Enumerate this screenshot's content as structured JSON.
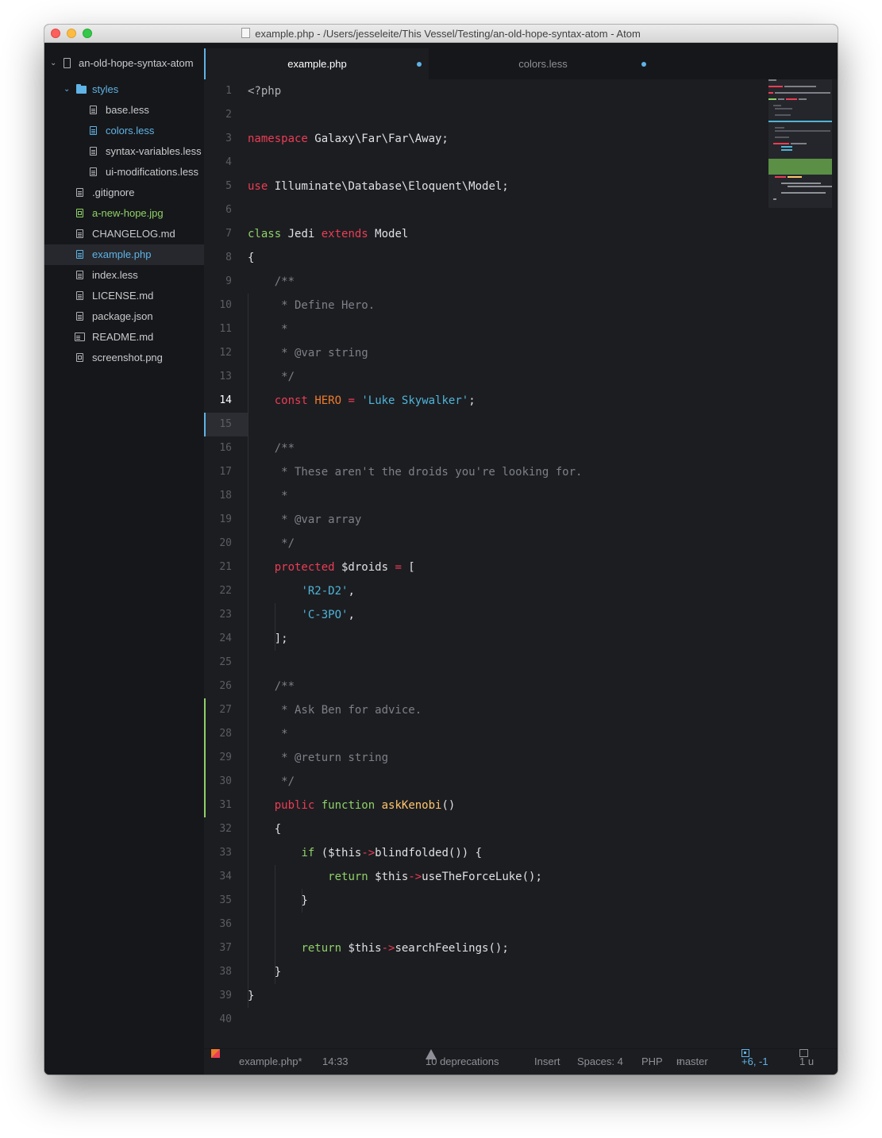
{
  "window": {
    "title": "example.php - /Users/jesseleite/This Vessel/Testing/an-old-hope-syntax-atom - Atom"
  },
  "sidebar": {
    "project": "an-old-hope-syntax-atom",
    "folder": "styles",
    "folder_items": [
      "base.less",
      "colors.less",
      "syntax-variables.less",
      "ui-modifications.less"
    ],
    "root_items": [
      ".gitignore",
      "a-new-hope.jpg",
      "CHANGELOG.md",
      "example.php",
      "index.less",
      "LICENSE.md",
      "package.json",
      "README.md",
      "screenshot.png"
    ]
  },
  "tabs": [
    {
      "label": "example.php",
      "active": true,
      "modified": true
    },
    {
      "label": "colors.less",
      "active": false,
      "modified": true
    }
  ],
  "editor": {
    "current_line": 14,
    "line_numbers": [
      "1",
      "2",
      "3",
      "4",
      "5",
      "6",
      "7",
      "8",
      "9",
      "10",
      "11",
      "12",
      "13",
      "14",
      "15",
      "16",
      "17",
      "18",
      "19",
      "20",
      "21",
      "22",
      "23",
      "24",
      "25",
      "26",
      "27",
      "28",
      "29",
      "30",
      "31",
      "32",
      "33",
      "34",
      "35",
      "36",
      "37",
      "38",
      "39",
      "40"
    ],
    "git_added_lines": [
      26,
      30
    ]
  },
  "statusbar": {
    "file": "example.php*",
    "cursor": "14:33",
    "deprecations": "10 deprecations",
    "mode": "Insert",
    "indent": "Spaces: 4",
    "grammar": "PHP",
    "branch": "master",
    "diff": "+6, -1",
    "updates": "1 u"
  },
  "colors": {
    "accent": "#5fb3e6",
    "red": "#eb3d54",
    "green": "#8fd168",
    "orange": "#ef7c2a",
    "yellow": "#ffc66d",
    "comment": "#7d8088"
  }
}
